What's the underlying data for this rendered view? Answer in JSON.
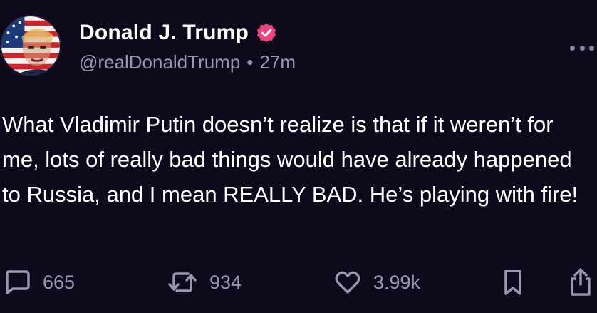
{
  "post": {
    "author": {
      "display_name": "Donald J. Trump",
      "handle": "@realDonaldTrump",
      "verified": true,
      "verified_badge_color": "#e8467c",
      "avatar_icon": "avatar-flag-portrait"
    },
    "separator": "•",
    "timestamp": "27m",
    "more_icon": "more-horizontal-icon",
    "text": "What Vladimir Putin doesn’t realize is that if it weren’t for me, lots of really bad things would have already happened to Russia, and I mean REALLY BAD. He’s playing with fire!"
  },
  "actions": {
    "reply": {
      "icon": "reply-bubble-icon",
      "count": "665"
    },
    "repost": {
      "icon": "repost-arrows-icon",
      "count": "934"
    },
    "like": {
      "icon": "heart-icon",
      "count": "3.99k"
    },
    "bookmark": {
      "icon": "bookmark-icon"
    },
    "share": {
      "icon": "share-upload-icon"
    }
  },
  "colors": {
    "background": "#0e0a1c",
    "text_primary": "#ffffff",
    "text_secondary": "#9a96ad"
  }
}
